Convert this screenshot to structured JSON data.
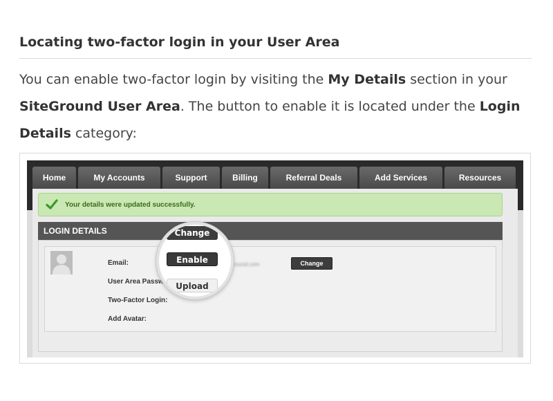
{
  "article": {
    "heading": "Locating two-factor login in your User Area",
    "intro": {
      "t1": "You can enable two-factor login by visiting the ",
      "b1": "My Details",
      "t2": " section in your ",
      "b2": "SiteGround User Area",
      "t3": ". The button to enable it is located under the ",
      "b3": "Login Details",
      "t4": " category:"
    }
  },
  "screenshot": {
    "tabs": [
      {
        "label": "Home"
      },
      {
        "label": "My Accounts"
      },
      {
        "label": "Support"
      },
      {
        "label": "Billing"
      },
      {
        "label": "Referral Deals"
      },
      {
        "label": "Add Services"
      },
      {
        "label": "Resources"
      }
    ],
    "success_message": "Your details were updated successfully.",
    "section_title": "LOGIN DETAILS",
    "fields": {
      "email_label": "Email:",
      "email_value": "george.v.ill...@siteground.com",
      "password_label": "User Area Password:",
      "two_factor_label": "Two-Factor Login:",
      "avatar_label": "Add Avatar:"
    },
    "buttons": {
      "email_change": "Change",
      "password_change": "Change",
      "enable": "Enable",
      "upload": "Upload"
    },
    "icons": {
      "success": "check-icon",
      "avatar": "user-avatar-icon"
    },
    "colors": {
      "success_bg": "#c9e8b3",
      "success_text": "#3d6a1e",
      "check": "#3a9a2a",
      "header_bg": "#555555"
    }
  }
}
